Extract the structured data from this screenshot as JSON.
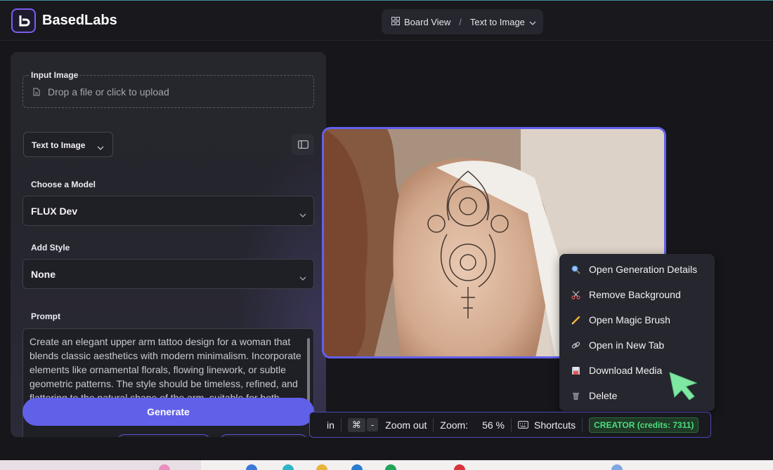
{
  "app": {
    "name": "BasedLabs"
  },
  "breadcrumb": {
    "board": "Board View",
    "separator": "/",
    "current": "Text to Image"
  },
  "panel": {
    "input_image_label": "Input Image",
    "upload_text": "Drop a file or click to upload",
    "mode_label": "Text to Image",
    "model_label": "Choose a Model",
    "model_value": "FLUX Dev",
    "style_label": "Add Style",
    "style_value": "None",
    "prompt_label": "Prompt",
    "prompt_text": "Create an elegant upper arm tattoo design for a woman that blends classic aesthetics with modern minimalism. Incorporate elements like ornamental florals, flowing linework, or subtle geometric patterns. The style should be timeless, refined, and flattering to the natural shape of the arm, suitable for both casual and formal outfits",
    "generate_label": "Generate"
  },
  "context_menu": {
    "items": [
      {
        "label": "Open Generation Details",
        "icon": "magnifier-icon"
      },
      {
        "label": "Remove Background",
        "icon": "scissors-icon"
      },
      {
        "label": "Open Magic Brush",
        "icon": "pencil-icon"
      },
      {
        "label": "Open in New Tab",
        "icon": "link-icon"
      },
      {
        "label": "Download Media",
        "icon": "floppy-disk-icon"
      },
      {
        "label": "Delete",
        "icon": "trash-icon"
      }
    ]
  },
  "toolbar": {
    "zoom_in_partial": "in",
    "shortcut_key": "⌘",
    "shortcut_minus": "-",
    "zoom_out_label": "Zoom out",
    "zoom_label": "Zoom:",
    "zoom_value": "56 %",
    "shortcuts_label": "Shortcuts",
    "credits_badge": "CREATOR (credits: 7311)"
  },
  "colors": {
    "accent": "#6160e8",
    "frame": "#6360f0",
    "credits_green": "#4ade80",
    "cursor_green": "#7ee8a2"
  }
}
